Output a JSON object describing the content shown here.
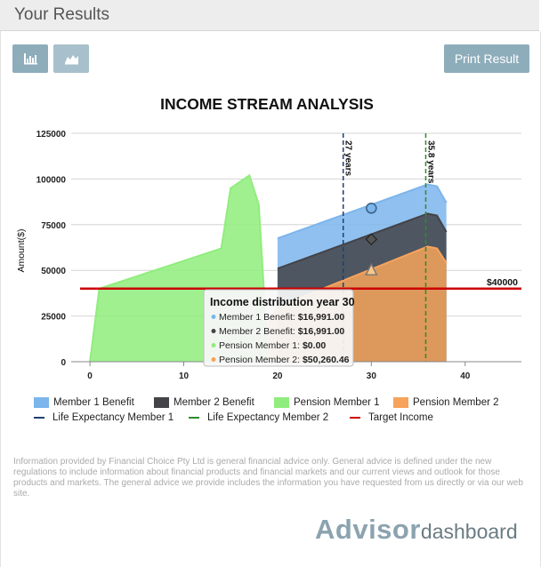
{
  "header": {
    "title": "Your Results"
  },
  "toolbar": {
    "print_label": "Print Result",
    "view_buttons": [
      "bar-chart-icon",
      "area-chart-icon"
    ]
  },
  "chart_data": {
    "type": "area",
    "title": "INCOME STREAM ANALYSIS",
    "ylabel": "Amount($)",
    "xlabel": "",
    "xlim": [
      -2,
      46
    ],
    "ylim": [
      0,
      125000
    ],
    "x_ticks": [
      0,
      10,
      20,
      30,
      40
    ],
    "y_ticks": [
      0,
      25000,
      50000,
      75000,
      100000,
      125000
    ],
    "y_tick_labels": [
      "0",
      "25000",
      "50000",
      "75000",
      "100000",
      "125000"
    ],
    "grid": true,
    "legend_position": "bottom",
    "series": [
      {
        "name": "Member 1 Benefit",
        "color": "#7cb5ec",
        "points": [
          [
            20,
            67500
          ],
          [
            36,
            97000
          ],
          [
            37,
            96000
          ],
          [
            38,
            87000
          ]
        ]
      },
      {
        "name": "Member 2 Benefit",
        "color": "#434348",
        "points": [
          [
            20,
            51000
          ],
          [
            36,
            81000
          ],
          [
            37,
            80000
          ],
          [
            38,
            71000
          ]
        ]
      },
      {
        "name": "Pension Member 1",
        "color": "#90ed7d",
        "points": [
          [
            0,
            0
          ],
          [
            1,
            40000
          ],
          [
            14,
            62000
          ],
          [
            15,
            95000
          ],
          [
            17,
            102000
          ],
          [
            18,
            86000
          ],
          [
            19,
            0
          ]
        ]
      },
      {
        "name": "Pension Member 2",
        "color": "#f7a35c",
        "points": [
          [
            19,
            20000
          ],
          [
            20,
            30000
          ],
          [
            36,
            63000
          ],
          [
            37,
            62000
          ],
          [
            38,
            54000
          ]
        ]
      }
    ],
    "reference_lines": {
      "horizontal": [
        {
          "name": "Target Income",
          "value": 40000,
          "label": "$40000",
          "color": "#cc0000"
        }
      ],
      "vertical": [
        {
          "name": "Life Expectancy Member 1",
          "value": 27,
          "label": "27 years",
          "color": "#1f3f73"
        },
        {
          "name": "Life Expectancy Member 2",
          "value": 35.8,
          "label": "35.8 years",
          "color": "#2e8b2e"
        }
      ]
    },
    "legend_lines": [
      {
        "name": "Life Expectancy Member 1",
        "color": "#1f3f73",
        "style": "dashed"
      },
      {
        "name": "Life Expectancy Member 2",
        "color": "#2e8b2e",
        "style": "dashed"
      },
      {
        "name": "Target Income",
        "color": "#cc0000",
        "style": "solid"
      }
    ],
    "tooltip": {
      "x": 30,
      "title": "Income distribution year 30",
      "rows": [
        {
          "label": "Member 1 Benefit:",
          "value": "$16,991.00",
          "color": "#7cb5ec"
        },
        {
          "label": "Member 2 Benefit:",
          "value": "$16,991.00",
          "color": "#434348"
        },
        {
          "label": "Pension Member 1:",
          "value": "$0.00",
          "color": "#90ed7d"
        },
        {
          "label": "Pension Member 2:",
          "value": "$50,260.46",
          "color": "#f7a35c"
        }
      ],
      "markers": [
        {
          "series": "Member 1 Benefit",
          "y": 84000,
          "shape": "circle"
        },
        {
          "series": "Member 2 Benefit",
          "y": 67000,
          "shape": "diamond"
        },
        {
          "series": "Pension Member 2",
          "y": 50000,
          "shape": "triangle"
        }
      ]
    }
  },
  "disclaimer": "Information provided by Financial Choice Pty Ltd is general financial advice only. General advice is defined under the new regulations to include information about financial products and financial markets and our current views and outlook for those products and markets. The general advice we provide includes the information you have requested from us directly or via our web site.",
  "brand": {
    "part1": "Advisor",
    "part2": "dashboard"
  }
}
